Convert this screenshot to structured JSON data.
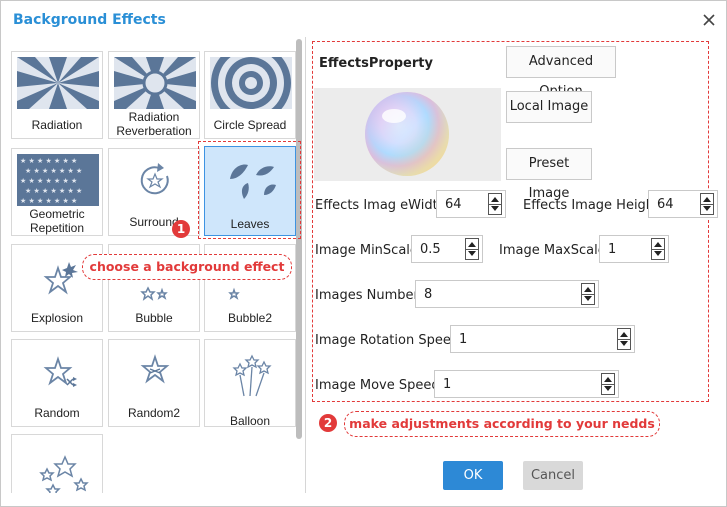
{
  "dialog": {
    "title": "Background Effects",
    "accent_color": "#2a8fd6"
  },
  "effects": {
    "items": [
      {
        "label": "Radiation",
        "icon": "radiation-icon",
        "selected": false
      },
      {
        "label": "Radiation Reverberation",
        "icon": "radiation-reverberation-icon",
        "selected": false
      },
      {
        "label": "Circle Spread",
        "icon": "circle-spread-icon",
        "selected": false
      },
      {
        "label": "Geometric Repetition",
        "icon": "geometric-repetition-icon",
        "selected": false
      },
      {
        "label": "Surround",
        "icon": "surround-icon",
        "selected": false
      },
      {
        "label": "Leaves",
        "icon": "leaves-icon",
        "selected": true
      },
      {
        "label": "Explosion",
        "icon": "explosion-icon",
        "selected": false
      },
      {
        "label": "Bubble",
        "icon": "bubble-icon",
        "selected": false
      },
      {
        "label": "Bubble2",
        "icon": "bubble2-icon",
        "selected": false
      },
      {
        "label": "Random",
        "icon": "random-icon",
        "selected": false
      },
      {
        "label": "Random2",
        "icon": "random2-icon",
        "selected": false
      },
      {
        "label": "Balloon",
        "icon": "balloon-icon",
        "selected": false
      },
      {
        "label": "",
        "icon": "stars-icon",
        "selected": false
      }
    ]
  },
  "annotations": {
    "step1": {
      "number": "1",
      "text": "choose a background effect"
    },
    "step2": {
      "number": "2",
      "text": "make adjustments according to your nedds"
    },
    "color": "#e23a3a"
  },
  "properties": {
    "title": "EffectsProperty",
    "buttons": {
      "advanced": "Advanced Option",
      "local_image": "Local Image",
      "preset_image": "Preset Image"
    },
    "fields": {
      "width": {
        "label": "Effects Imag eWidth",
        "value": "64"
      },
      "height": {
        "label": "Effects Image Height",
        "value": "64"
      },
      "min_scale": {
        "label": "Image MinScale",
        "value": "0.5"
      },
      "max_scale": {
        "label": "Image MaxScale",
        "value": "1"
      },
      "number": {
        "label": "Images Number",
        "value": "8"
      },
      "rotation_speed": {
        "label": "Image Rotation Speed",
        "value": "1"
      },
      "move_speed": {
        "label": "Image Move Speed",
        "value": "1"
      }
    }
  },
  "footer": {
    "ok": "OK",
    "cancel": "Cancel",
    "ok_color": "#2d89d6"
  }
}
